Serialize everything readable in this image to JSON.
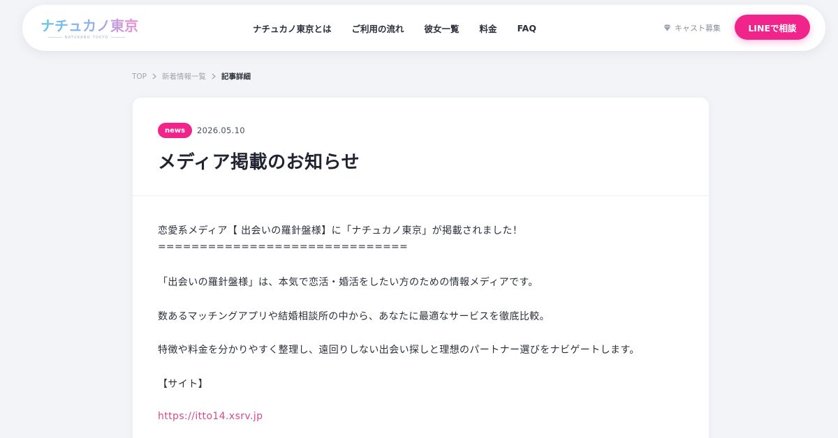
{
  "header": {
    "logo_text": "ナチュカノ東京",
    "logo_sub": "NATUKANO TOKYO",
    "nav": [
      "ナチュカノ東京とは",
      "ご利用の流れ",
      "彼女一覧",
      "料金",
      "FAQ"
    ],
    "cast_label": "キャスト募集",
    "line_button": "LINEで相談"
  },
  "breadcrumb": {
    "items": [
      "TOP",
      "新着情報一覧"
    ],
    "current": "記事詳細"
  },
  "article": {
    "category": "news",
    "date": "2026.05.10",
    "title": "メディア掲載のお知らせ",
    "paragraphs": [
      "恋愛系メディア【 出会いの羅針盤様】に「ナチュカノ東京」が掲載されました！",
      "==============================",
      "「出会いの羅針盤様」は、本気で恋活・婚活をしたい方のための情報メディアです。",
      "数あるマッチングアプリや結婚相談所の中から、あなたに最適なサービスを徹底比較。",
      "特徴や料金を分かりやすく整理し、遠回りしない出会い探しと理想のパートナー選びをナビゲートします。",
      "【サイト】"
    ],
    "link": "https://itto14.xsrv.jp"
  },
  "colors": {
    "accent": "#f0248a",
    "link": "#d64a8c",
    "background": "#f3f4f8"
  },
  "icons": {
    "cast": "diamond-icon",
    "breadcrumb_separator": "chevron-right-icon"
  }
}
